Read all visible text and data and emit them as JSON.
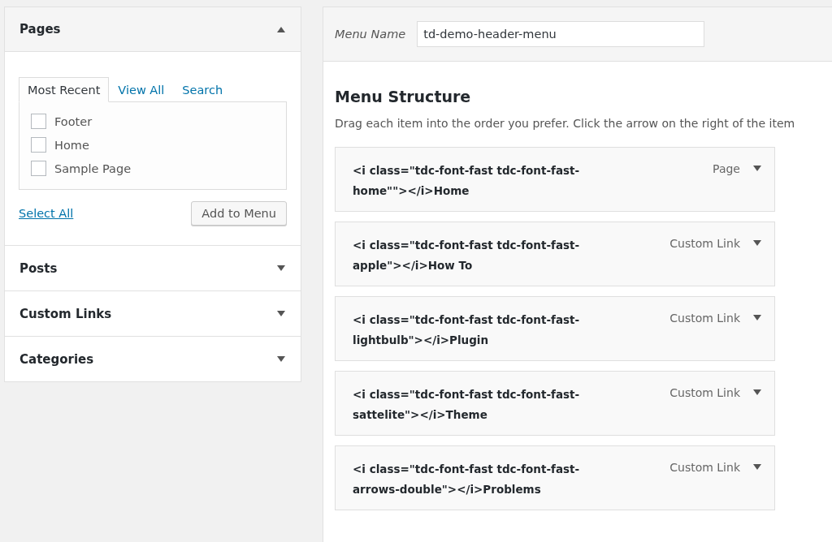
{
  "accordion": [
    {
      "title": "Pages",
      "expanded": true,
      "tabs": [
        {
          "label": "Most Recent",
          "selected": true
        },
        {
          "label": "View All",
          "selected": false
        },
        {
          "label": "Search",
          "selected": false
        }
      ],
      "items": [
        {
          "label": "Footer",
          "checked": false
        },
        {
          "label": "Home",
          "checked": false
        },
        {
          "label": "Sample Page",
          "checked": false
        }
      ],
      "select_all": "Select All",
      "add_button": "Add to Menu"
    },
    {
      "title": "Posts",
      "expanded": false
    },
    {
      "title": "Custom Links",
      "expanded": false
    },
    {
      "title": "Categories",
      "expanded": false
    }
  ],
  "menu": {
    "name_label": "Menu Name",
    "name_value": "td-demo-header-menu",
    "structure_title": "Menu Structure",
    "instructions": "Drag each item into the order you prefer. Click the arrow on the right of the item",
    "items": [
      {
        "title": "<i class=\"tdc-font-fast tdc-font-fast-home\"\"></i>Home",
        "type": "Page"
      },
      {
        "title": "<i class=\"tdc-font-fast tdc-font-fast-apple\"></i>How To",
        "type": "Custom Link"
      },
      {
        "title": "<i class=\"tdc-font-fast tdc-font-fast-lightbulb\"></i>Plugin",
        "type": "Custom Link"
      },
      {
        "title": "<i class=\"tdc-font-fast tdc-font-fast-sattelite\"></i>Theme",
        "type": "Custom Link"
      },
      {
        "title": "<i class=\"tdc-font-fast tdc-font-fast-arrows-double\"></i>Problems",
        "type": "Custom Link"
      }
    ]
  }
}
